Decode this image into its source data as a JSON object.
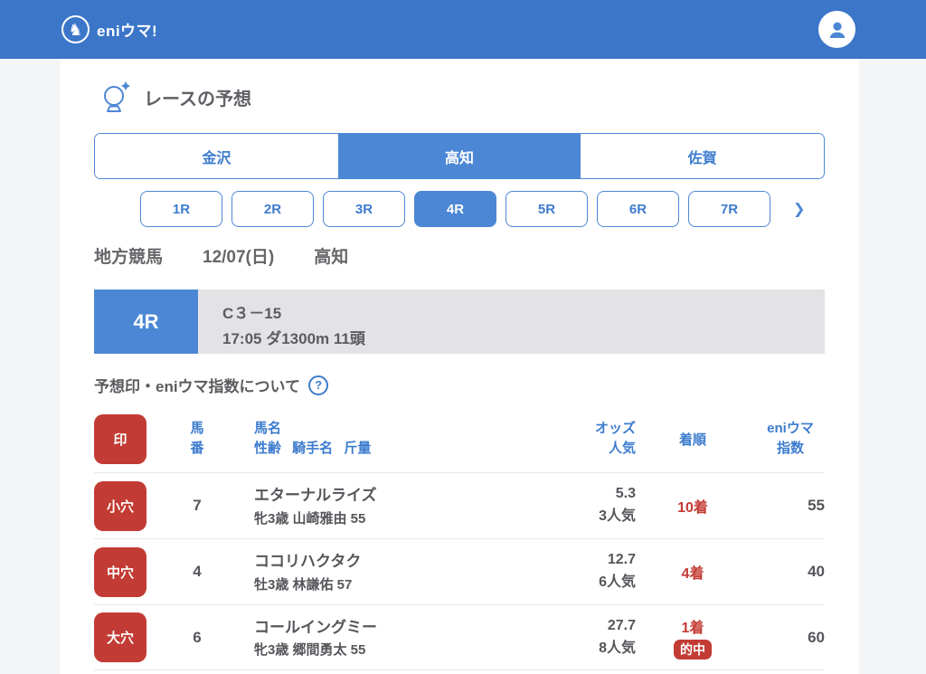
{
  "colors": {
    "header_blue": "#3B76C8",
    "accent_blue": "#4C87D5",
    "link_blue": "#3D7CCE",
    "badge_red": "#C23B34",
    "banner_gray": "#E3E3E5",
    "text_gray": "#55565A",
    "page_bg": "#F4F5F7"
  },
  "header": {
    "logo_text": "eniウマ!",
    "horse_icon": "♞"
  },
  "page_title": "レースの予想",
  "venue_tabs": [
    {
      "label": "金沢",
      "active": false
    },
    {
      "label": "高知",
      "active": true
    },
    {
      "label": "佐賀",
      "active": false
    }
  ],
  "race_tabs": {
    "items": [
      {
        "label": "1R",
        "active": false
      },
      {
        "label": "2R",
        "active": false
      },
      {
        "label": "3R",
        "active": false
      },
      {
        "label": "4R",
        "active": true
      },
      {
        "label": "5R",
        "active": false
      },
      {
        "label": "6R",
        "active": false
      },
      {
        "label": "7R",
        "active": false
      }
    ],
    "next_icon": "❯"
  },
  "race_meta": {
    "category": "地方競馬",
    "date": "12/07(日)",
    "venue": "高知"
  },
  "race_banner": {
    "race_no": "4R",
    "race_class": "C３－15",
    "race_details": "17:05 ダ1300m 11頭"
  },
  "info_link": {
    "label": "予想印・eniウマ指数について",
    "help_icon": "?"
  },
  "table": {
    "headers": {
      "mark": "印",
      "horse_no_line1": "馬",
      "horse_no_line2": "番",
      "name_line1": "馬名",
      "name_line2": "性齢 騎手名 斤量",
      "odds_line1": "オッズ",
      "odds_line2": "人気",
      "result": "着順",
      "index_line1": "eniウマ",
      "index_line2": "指数"
    },
    "rows": [
      {
        "mark": "小穴",
        "num": "7",
        "name": "エターナルライズ",
        "detail": "牝3歳 山崎雅由 55",
        "odds": "5.3",
        "popularity": "3人気",
        "result": "10着",
        "hit": "",
        "index": "55"
      },
      {
        "mark": "中穴",
        "num": "4",
        "name": "ココリハクタク",
        "detail": "牡3歳 林謙佑 57",
        "odds": "12.7",
        "popularity": "6人気",
        "result": "4着",
        "hit": "",
        "index": "40"
      },
      {
        "mark": "大穴",
        "num": "6",
        "name": "コールイングミー",
        "detail": "牝3歳 郷間勇太 55",
        "odds": "27.7",
        "popularity": "8人気",
        "result": "1着",
        "hit": "的中",
        "index": "60"
      }
    ]
  }
}
